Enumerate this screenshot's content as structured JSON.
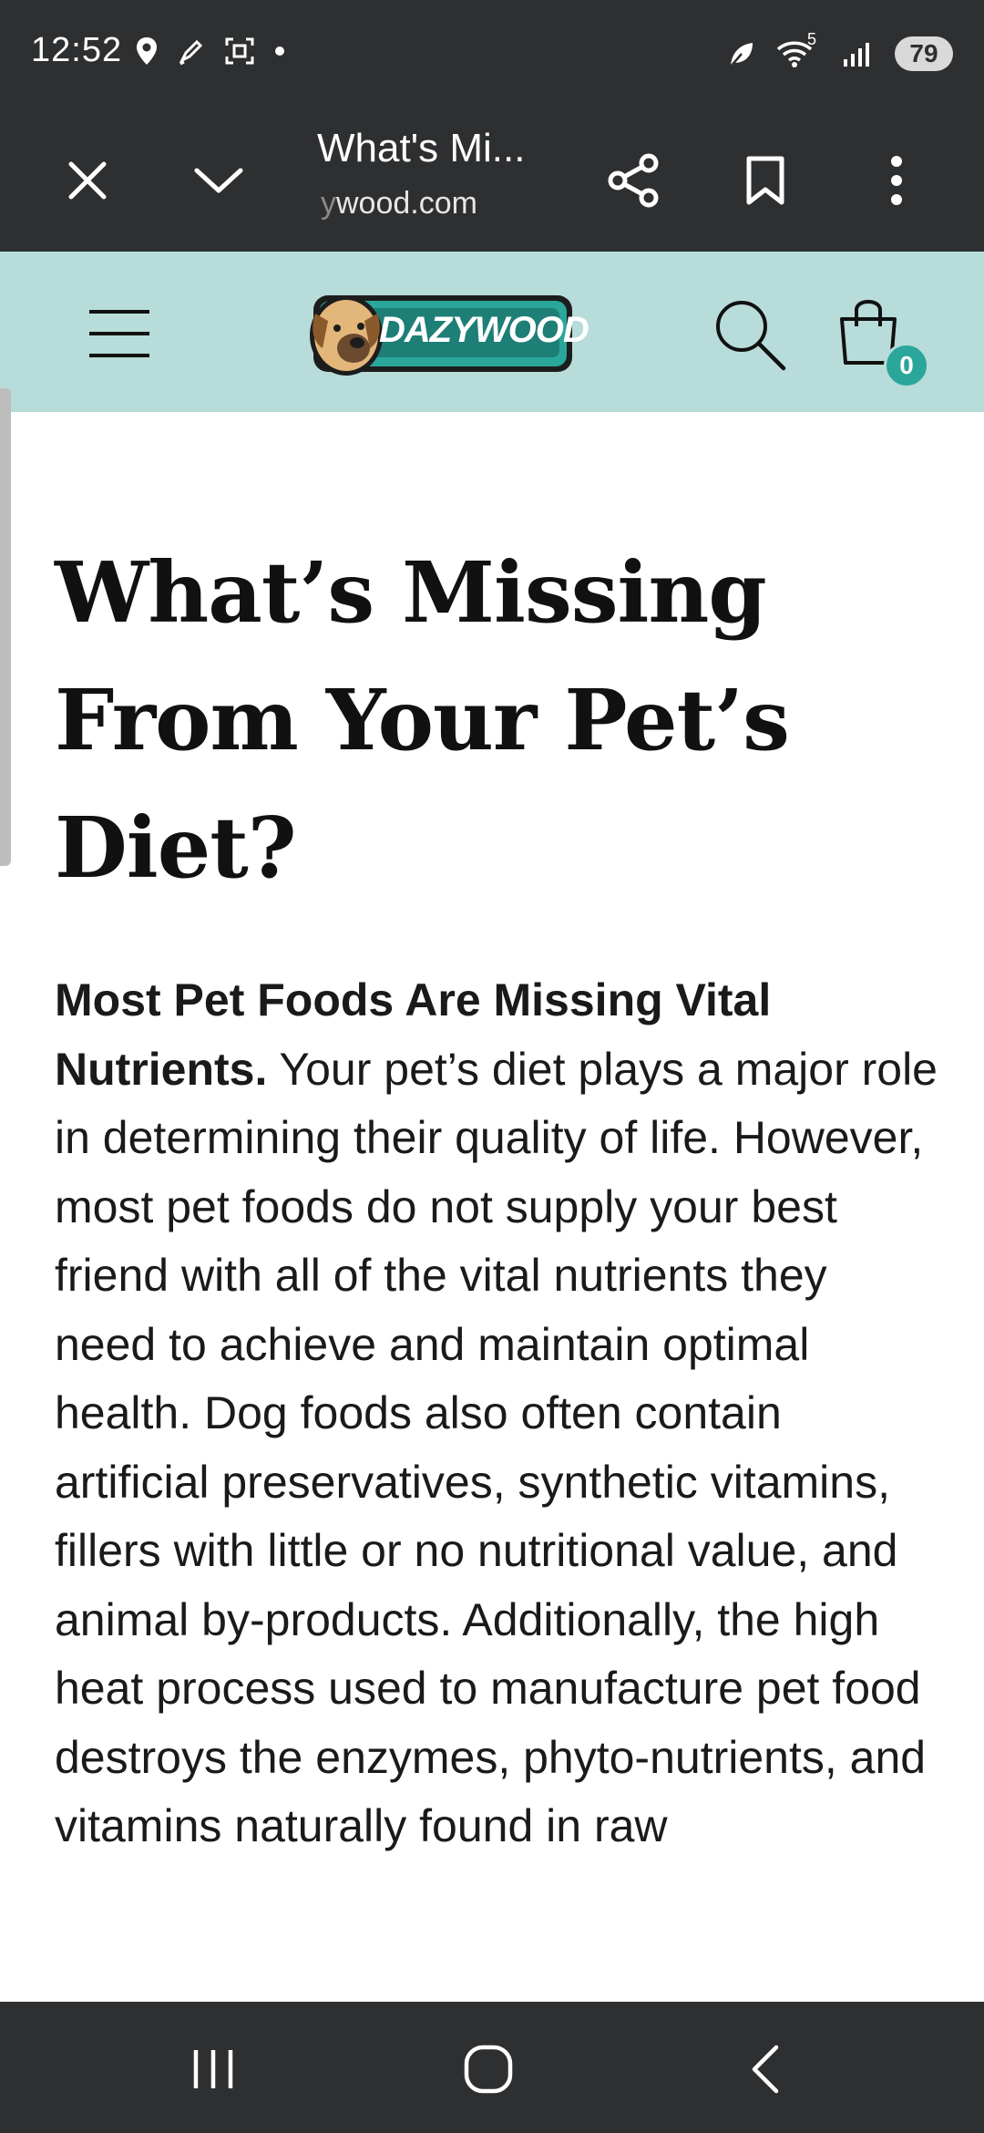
{
  "status_bar": {
    "time": "12:52",
    "signal_label": "5",
    "battery": "79"
  },
  "browser": {
    "title": "What's Mi...",
    "url_faded": "y",
    "url": "wood.com"
  },
  "site": {
    "logo_text": "DAZYWOOD",
    "cart_count": "0",
    "accent_color": "#2aa69b",
    "header_color": "#b7dcd9"
  },
  "article": {
    "title": "What’s Missing From Your Pet’s Diet?",
    "lead": "Most Pet Foods Are Missing Vital Nutrients.",
    "body": "Your pet’s diet plays a major role in determining their quality of life.  However, most pet foods do not supply your best friend with all of the vital nutrients they need to achieve and maintain optimal health.  Dog foods also often contain artificial preservatives, synthetic vitamins, fillers with little or no nutritional value, and animal by-products.  Additionally, the high heat process used to manufacture pet food destroys the enzymes, phyto-nutrients, and vitamins naturally found in raw"
  }
}
